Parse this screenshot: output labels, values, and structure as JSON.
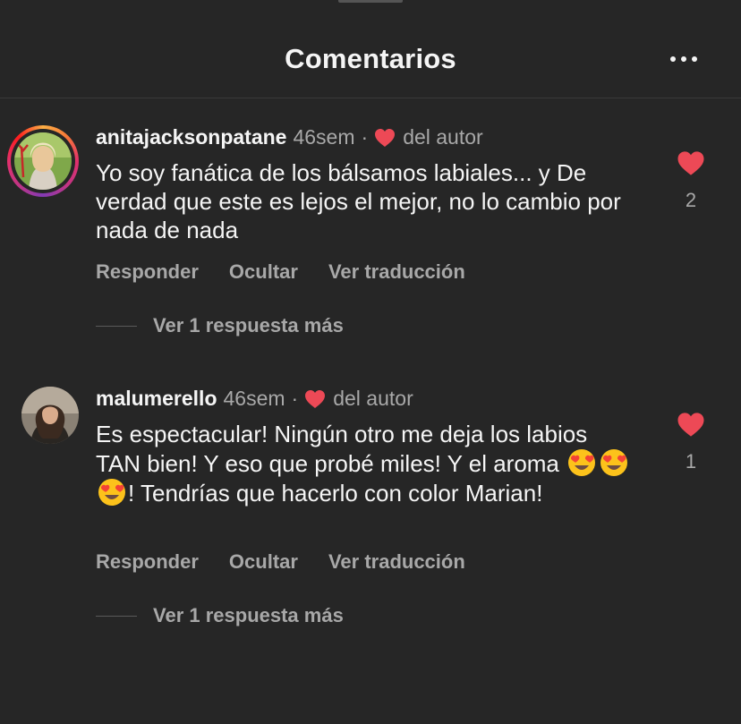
{
  "header": {
    "title": "Comentarios",
    "more_icon": "more-horizontal-icon"
  },
  "colors": {
    "background": "#262626",
    "heart": "#ed4956",
    "secondary_text": "#a8a8a8"
  },
  "comments": [
    {
      "username": "anitajacksonpatane",
      "time": "46sem",
      "separator": "·",
      "author_like_label": "del autor",
      "text": "Yo soy fanática de los bálsamos labiales... y De verdad que este es lejos el mejor, no lo cambio por nada de nada",
      "actions": {
        "reply": "Responder",
        "hide": "Ocultar",
        "translate": "Ver traducción"
      },
      "replies_label": "Ver 1 respuesta más",
      "like_count": "2",
      "has_story_ring": true
    },
    {
      "username": "malumerello",
      "time": "46sem",
      "separator": "·",
      "author_like_label": "del autor",
      "text_part1": "Es espectacular! Ningún otro me deja los labios TAN bien! Y eso que probé miles! Y el aroma",
      "emojis": [
        "heart-eyes-emoji",
        "heart-eyes-emoji",
        "heart-eyes-emoji"
      ],
      "text_part2": "! Tendrías que hacerlo con color Marian!",
      "actions": {
        "reply": "Responder",
        "hide": "Ocultar",
        "translate": "Ver traducción"
      },
      "replies_label": "Ver 1 respuesta más",
      "like_count": "1",
      "has_story_ring": false
    }
  ]
}
